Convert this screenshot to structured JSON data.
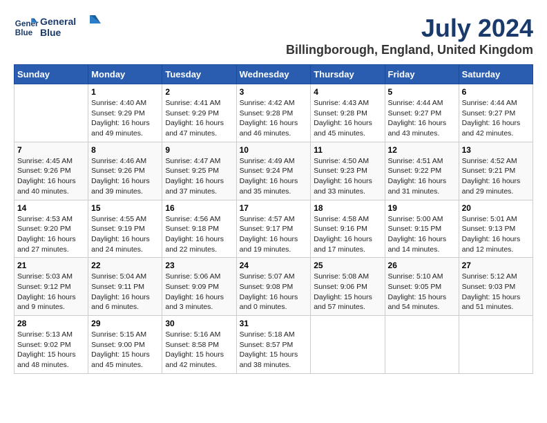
{
  "header": {
    "logo_line1": "General",
    "logo_line2": "Blue",
    "month_year": "July 2024",
    "location": "Billingborough, England, United Kingdom"
  },
  "calendar": {
    "days_of_week": [
      "Sunday",
      "Monday",
      "Tuesday",
      "Wednesday",
      "Thursday",
      "Friday",
      "Saturday"
    ],
    "weeks": [
      [
        {
          "date": "",
          "sunrise": "",
          "sunset": "",
          "daylight": ""
        },
        {
          "date": "1",
          "sunrise": "Sunrise: 4:40 AM",
          "sunset": "Sunset: 9:29 PM",
          "daylight": "Daylight: 16 hours and 49 minutes."
        },
        {
          "date": "2",
          "sunrise": "Sunrise: 4:41 AM",
          "sunset": "Sunset: 9:29 PM",
          "daylight": "Daylight: 16 hours and 47 minutes."
        },
        {
          "date": "3",
          "sunrise": "Sunrise: 4:42 AM",
          "sunset": "Sunset: 9:28 PM",
          "daylight": "Daylight: 16 hours and 46 minutes."
        },
        {
          "date": "4",
          "sunrise": "Sunrise: 4:43 AM",
          "sunset": "Sunset: 9:28 PM",
          "daylight": "Daylight: 16 hours and 45 minutes."
        },
        {
          "date": "5",
          "sunrise": "Sunrise: 4:44 AM",
          "sunset": "Sunset: 9:27 PM",
          "daylight": "Daylight: 16 hours and 43 minutes."
        },
        {
          "date": "6",
          "sunrise": "Sunrise: 4:44 AM",
          "sunset": "Sunset: 9:27 PM",
          "daylight": "Daylight: 16 hours and 42 minutes."
        }
      ],
      [
        {
          "date": "7",
          "sunrise": "Sunrise: 4:45 AM",
          "sunset": "Sunset: 9:26 PM",
          "daylight": "Daylight: 16 hours and 40 minutes."
        },
        {
          "date": "8",
          "sunrise": "Sunrise: 4:46 AM",
          "sunset": "Sunset: 9:26 PM",
          "daylight": "Daylight: 16 hours and 39 minutes."
        },
        {
          "date": "9",
          "sunrise": "Sunrise: 4:47 AM",
          "sunset": "Sunset: 9:25 PM",
          "daylight": "Daylight: 16 hours and 37 minutes."
        },
        {
          "date": "10",
          "sunrise": "Sunrise: 4:49 AM",
          "sunset": "Sunset: 9:24 PM",
          "daylight": "Daylight: 16 hours and 35 minutes."
        },
        {
          "date": "11",
          "sunrise": "Sunrise: 4:50 AM",
          "sunset": "Sunset: 9:23 PM",
          "daylight": "Daylight: 16 hours and 33 minutes."
        },
        {
          "date": "12",
          "sunrise": "Sunrise: 4:51 AM",
          "sunset": "Sunset: 9:22 PM",
          "daylight": "Daylight: 16 hours and 31 minutes."
        },
        {
          "date": "13",
          "sunrise": "Sunrise: 4:52 AM",
          "sunset": "Sunset: 9:21 PM",
          "daylight": "Daylight: 16 hours and 29 minutes."
        }
      ],
      [
        {
          "date": "14",
          "sunrise": "Sunrise: 4:53 AM",
          "sunset": "Sunset: 9:20 PM",
          "daylight": "Daylight: 16 hours and 27 minutes."
        },
        {
          "date": "15",
          "sunrise": "Sunrise: 4:55 AM",
          "sunset": "Sunset: 9:19 PM",
          "daylight": "Daylight: 16 hours and 24 minutes."
        },
        {
          "date": "16",
          "sunrise": "Sunrise: 4:56 AM",
          "sunset": "Sunset: 9:18 PM",
          "daylight": "Daylight: 16 hours and 22 minutes."
        },
        {
          "date": "17",
          "sunrise": "Sunrise: 4:57 AM",
          "sunset": "Sunset: 9:17 PM",
          "daylight": "Daylight: 16 hours and 19 minutes."
        },
        {
          "date": "18",
          "sunrise": "Sunrise: 4:58 AM",
          "sunset": "Sunset: 9:16 PM",
          "daylight": "Daylight: 16 hours and 17 minutes."
        },
        {
          "date": "19",
          "sunrise": "Sunrise: 5:00 AM",
          "sunset": "Sunset: 9:15 PM",
          "daylight": "Daylight: 16 hours and 14 minutes."
        },
        {
          "date": "20",
          "sunrise": "Sunrise: 5:01 AM",
          "sunset": "Sunset: 9:13 PM",
          "daylight": "Daylight: 16 hours and 12 minutes."
        }
      ],
      [
        {
          "date": "21",
          "sunrise": "Sunrise: 5:03 AM",
          "sunset": "Sunset: 9:12 PM",
          "daylight": "Daylight: 16 hours and 9 minutes."
        },
        {
          "date": "22",
          "sunrise": "Sunrise: 5:04 AM",
          "sunset": "Sunset: 9:11 PM",
          "daylight": "Daylight: 16 hours and 6 minutes."
        },
        {
          "date": "23",
          "sunrise": "Sunrise: 5:06 AM",
          "sunset": "Sunset: 9:09 PM",
          "daylight": "Daylight: 16 hours and 3 minutes."
        },
        {
          "date": "24",
          "sunrise": "Sunrise: 5:07 AM",
          "sunset": "Sunset: 9:08 PM",
          "daylight": "Daylight: 16 hours and 0 minutes."
        },
        {
          "date": "25",
          "sunrise": "Sunrise: 5:08 AM",
          "sunset": "Sunset: 9:06 PM",
          "daylight": "Daylight: 15 hours and 57 minutes."
        },
        {
          "date": "26",
          "sunrise": "Sunrise: 5:10 AM",
          "sunset": "Sunset: 9:05 PM",
          "daylight": "Daylight: 15 hours and 54 minutes."
        },
        {
          "date": "27",
          "sunrise": "Sunrise: 5:12 AM",
          "sunset": "Sunset: 9:03 PM",
          "daylight": "Daylight: 15 hours and 51 minutes."
        }
      ],
      [
        {
          "date": "28",
          "sunrise": "Sunrise: 5:13 AM",
          "sunset": "Sunset: 9:02 PM",
          "daylight": "Daylight: 15 hours and 48 minutes."
        },
        {
          "date": "29",
          "sunrise": "Sunrise: 5:15 AM",
          "sunset": "Sunset: 9:00 PM",
          "daylight": "Daylight: 15 hours and 45 minutes."
        },
        {
          "date": "30",
          "sunrise": "Sunrise: 5:16 AM",
          "sunset": "Sunset: 8:58 PM",
          "daylight": "Daylight: 15 hours and 42 minutes."
        },
        {
          "date": "31",
          "sunrise": "Sunrise: 5:18 AM",
          "sunset": "Sunset: 8:57 PM",
          "daylight": "Daylight: 15 hours and 38 minutes."
        },
        {
          "date": "",
          "sunrise": "",
          "sunset": "",
          "daylight": ""
        },
        {
          "date": "",
          "sunrise": "",
          "sunset": "",
          "daylight": ""
        },
        {
          "date": "",
          "sunrise": "",
          "sunset": "",
          "daylight": ""
        }
      ]
    ]
  }
}
